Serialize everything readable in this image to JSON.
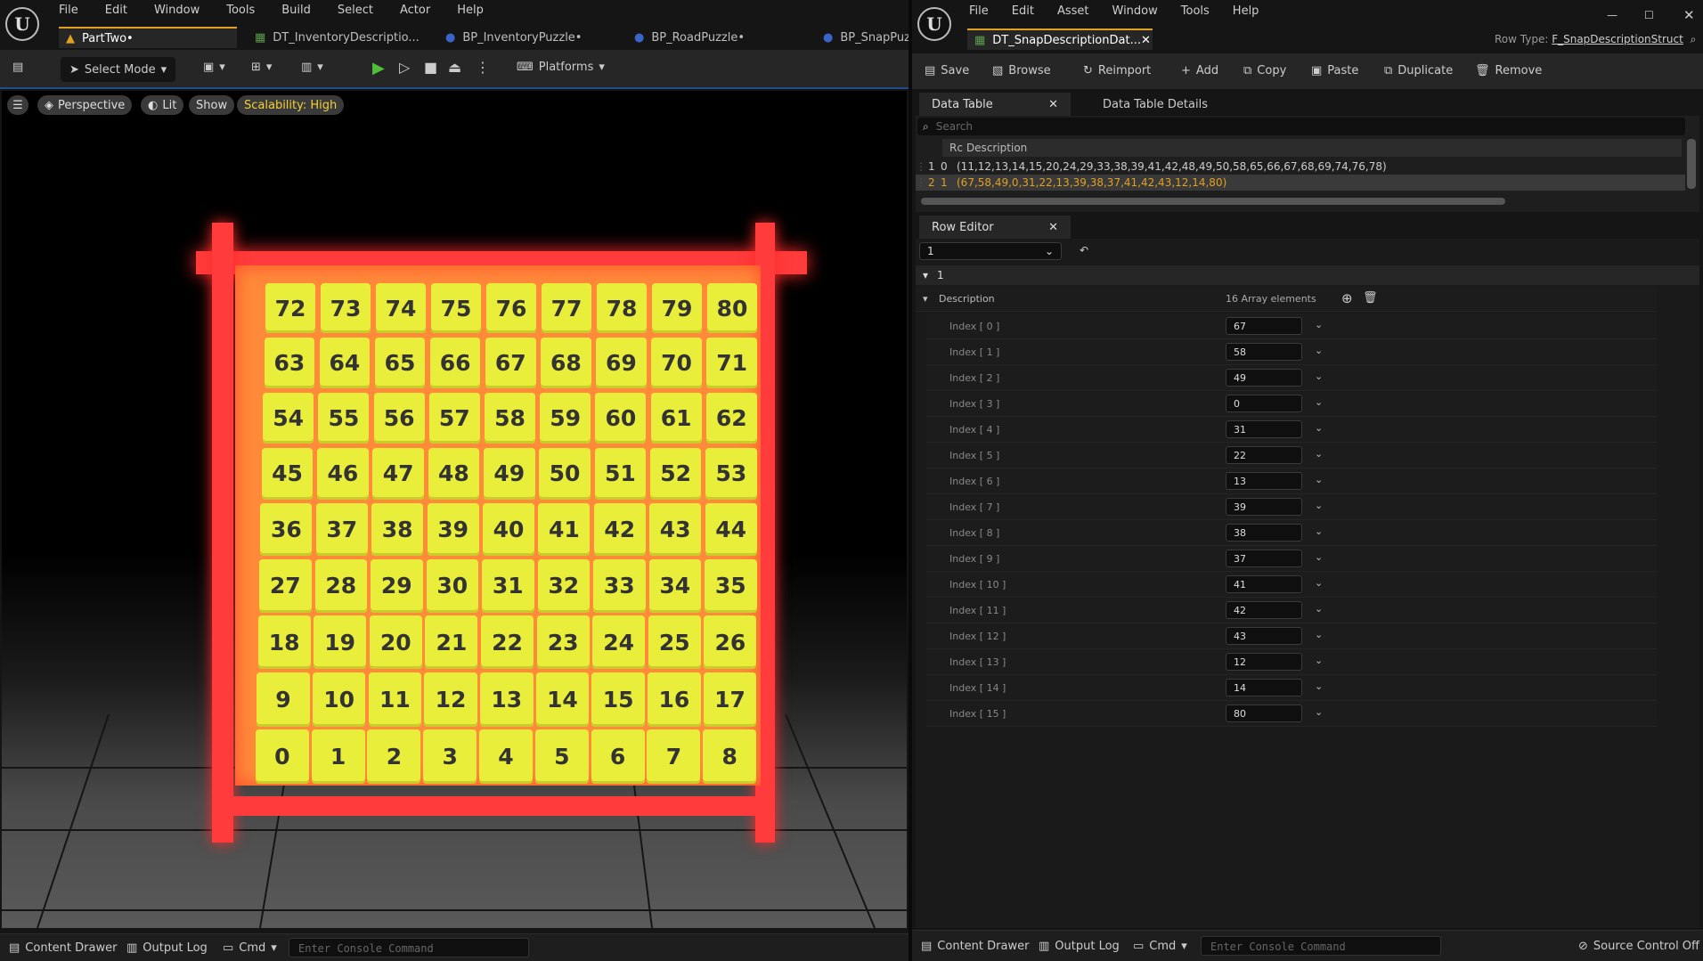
{
  "left": {
    "menu": [
      "File",
      "Edit",
      "Window",
      "Tools",
      "Build",
      "Select",
      "Actor",
      "Help"
    ],
    "tabs": [
      "PartTwo•",
      "DT_InventoryDescriptio...",
      "BP_InventoryPuzzle•",
      "BP_RoadPuzzle•",
      "BP_SnapPuz"
    ],
    "toolbar": {
      "select_mode": "Select Mode",
      "platforms": "Platforms"
    },
    "viewport": {
      "perspective": "Perspective",
      "lit": "Lit",
      "show": "Show",
      "scalability": "Scalability: High"
    },
    "grid": [
      [
        "72",
        "73",
        "74",
        "75",
        "76",
        "77",
        "78",
        "79",
        "80"
      ],
      [
        "63",
        "64",
        "65",
        "66",
        "67",
        "68",
        "69",
        "70",
        "71"
      ],
      [
        "54",
        "55",
        "56",
        "57",
        "58",
        "59",
        "60",
        "61",
        "62"
      ],
      [
        "45",
        "46",
        "47",
        "48",
        "49",
        "50",
        "51",
        "52",
        "53"
      ],
      [
        "36",
        "37",
        "38",
        "39",
        "40",
        "41",
        "42",
        "43",
        "44"
      ],
      [
        "27",
        "28",
        "29",
        "30",
        "31",
        "32",
        "33",
        "34",
        "35"
      ],
      [
        "18",
        "19",
        "20",
        "21",
        "22",
        "23",
        "24",
        "25",
        "26"
      ],
      [
        "9",
        "10",
        "11",
        "12",
        "13",
        "14",
        "15",
        "16",
        "17"
      ],
      [
        "0",
        "1",
        "2",
        "3",
        "4",
        "5",
        "6",
        "7",
        "8"
      ]
    ],
    "bottom": {
      "content_drawer": "Content Drawer",
      "output_log": "Output Log",
      "cmd": "Cmd",
      "console_placeholder": "Enter Console Command"
    }
  },
  "right": {
    "menu": [
      "File",
      "Edit",
      "Asset",
      "Window",
      "Tools",
      "Help"
    ],
    "tab": "DT_SnapDescriptionDat...",
    "row_type_label": "Row Type:",
    "row_type_value": "F_SnapDescriptionStruct",
    "toolbar": {
      "save": "Save",
      "browse": "Browse",
      "reimport": "Reimport",
      "add": "Add",
      "copy": "Copy",
      "paste": "Paste",
      "duplicate": "Duplicate",
      "remove": "Remove"
    },
    "panel_tabs": {
      "data_table": "Data Table",
      "details": "Data Table Details"
    },
    "search_placeholder": "Search",
    "table_header": {
      "rc": "Rc",
      "desc": "Description"
    },
    "rows": [
      {
        "num": "1",
        "name": "0",
        "desc": "(11,12,13,14,15,20,24,29,33,38,39,41,42,48,49,50,58,65,66,67,68,69,74,76,78)"
      },
      {
        "num": "2",
        "name": "1",
        "desc": "(67,58,49,0,31,22,13,39,38,37,41,42,43,12,14,80)"
      }
    ],
    "row_editor": {
      "title": "Row Editor",
      "selected": "1",
      "section": "1",
      "desc_label": "Description",
      "array_count": "16 Array elements"
    },
    "indices": [
      {
        "label": "Index [ 0 ]",
        "value": "67"
      },
      {
        "label": "Index [ 1 ]",
        "value": "58"
      },
      {
        "label": "Index [ 2 ]",
        "value": "49"
      },
      {
        "label": "Index [ 3 ]",
        "value": "0"
      },
      {
        "label": "Index [ 4 ]",
        "value": "31"
      },
      {
        "label": "Index [ 5 ]",
        "value": "22"
      },
      {
        "label": "Index [ 6 ]",
        "value": "13"
      },
      {
        "label": "Index [ 7 ]",
        "value": "39"
      },
      {
        "label": "Index [ 8 ]",
        "value": "38"
      },
      {
        "label": "Index [ 9 ]",
        "value": "37"
      },
      {
        "label": "Index [ 10 ]",
        "value": "41"
      },
      {
        "label": "Index [ 11 ]",
        "value": "42"
      },
      {
        "label": "Index [ 12 ]",
        "value": "43"
      },
      {
        "label": "Index [ 13 ]",
        "value": "12"
      },
      {
        "label": "Index [ 14 ]",
        "value": "14"
      },
      {
        "label": "Index [ 15 ]",
        "value": "80"
      }
    ],
    "bottom": {
      "content_drawer": "Content Drawer",
      "output_log": "Output Log",
      "cmd": "Cmd",
      "console_placeholder": "Enter Console Command",
      "source_control": "Source Control Off"
    }
  },
  "colors": {
    "accent": "#e2a01f",
    "tile": "#e9ee3a",
    "frame": "#ff3a3a",
    "selected_row": "#e2a01f"
  }
}
